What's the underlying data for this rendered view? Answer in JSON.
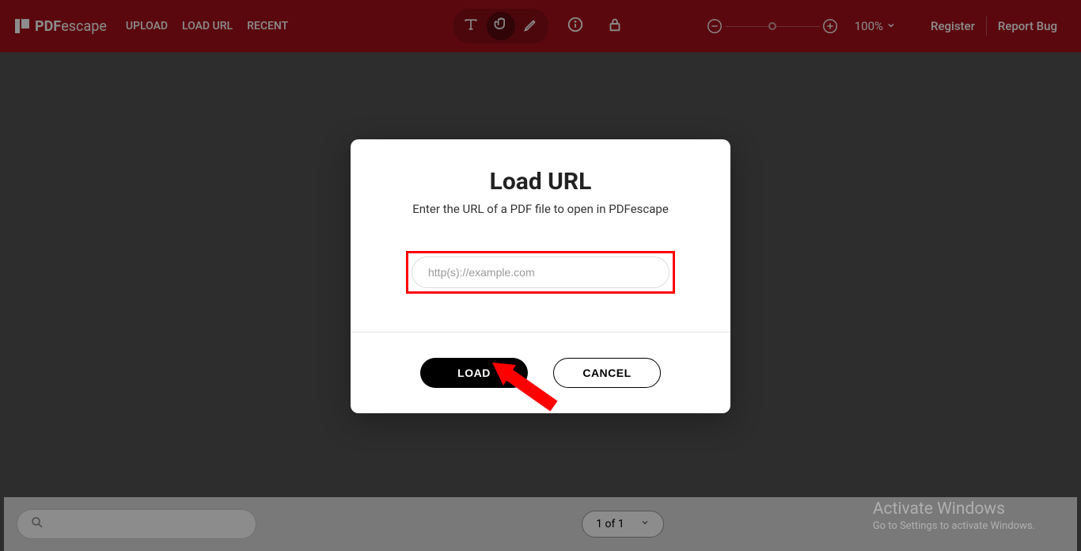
{
  "brand": {
    "name_bold": "PDF",
    "name_light": "escape"
  },
  "nav": {
    "upload": "UPLOAD",
    "load_url": "LOAD URL",
    "recent": "RECENT"
  },
  "zoom": {
    "level": "100%"
  },
  "links": {
    "register": "Register",
    "report_bug": "Report Bug"
  },
  "modal": {
    "title": "Load URL",
    "subtitle": "Enter the URL of a PDF file to open in PDFescape",
    "placeholder": "http(s)://example.com",
    "load_btn": "LOAD",
    "cancel_btn": "CANCEL"
  },
  "pager": {
    "label": "1 of 1"
  },
  "watermark": {
    "title": "Activate Windows",
    "subtitle": "Go to Settings to activate Windows."
  }
}
